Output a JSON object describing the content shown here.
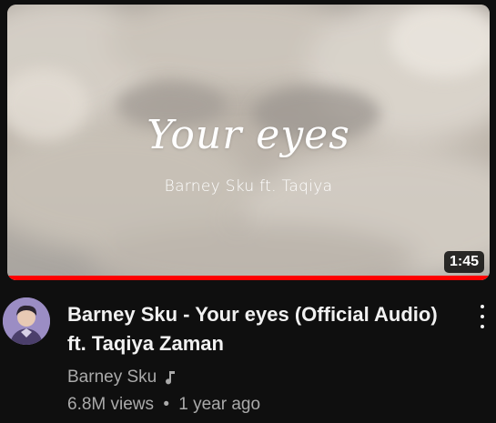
{
  "video": {
    "thumbnail_title": "Your eyes",
    "thumbnail_subtitle": "Barney Sku ft. Taqiya",
    "duration": "1:45",
    "watched_fraction": 1.0,
    "title": "Barney Sku - Your eyes (Official Audio) ft. Taqiya Zaman",
    "channel": "Barney Sku",
    "channel_badge_icon": "music-note-icon",
    "views": "6.8M views",
    "separator": "•",
    "age": "1 year ago",
    "menu_icon": "more-vert-icon"
  },
  "colors": {
    "background": "#0f0f0f",
    "progress": "#ff0000",
    "title_text": "#f1f1f1",
    "secondary_text": "#aaaaaa"
  }
}
